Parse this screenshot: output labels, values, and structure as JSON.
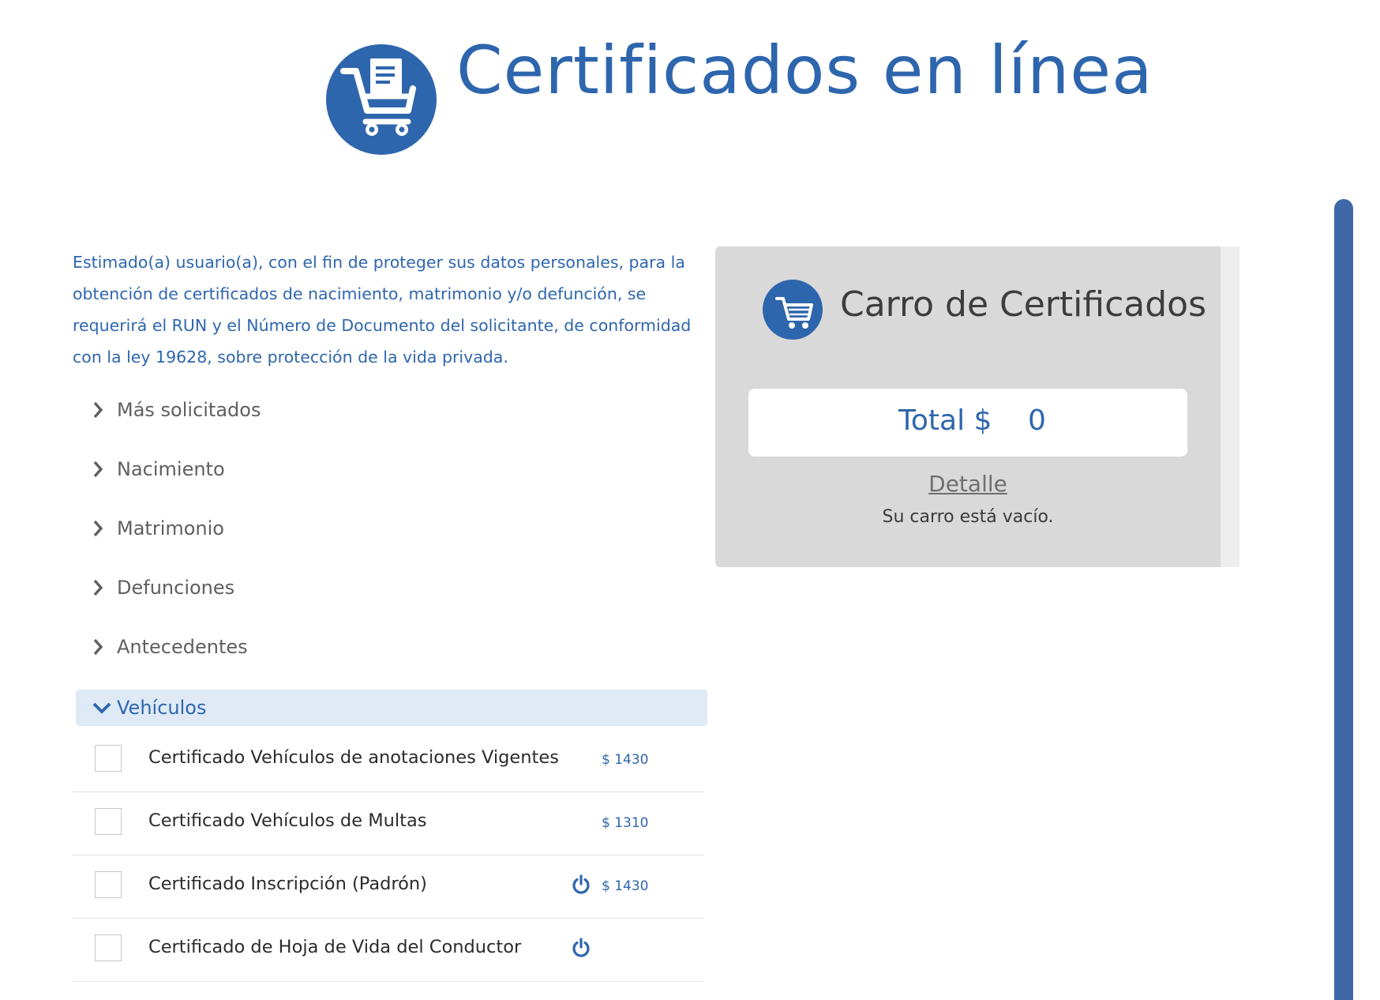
{
  "header": {
    "title": "Certificados en línea",
    "logo_icon": "cart-document-icon"
  },
  "notice": {
    "text": "Estimado(a) usuario(a), con el fin de proteger sus datos personales, para la obtención de certificados de nacimiento, matrimonio y/o defunción, se requerirá el RUN y el Número de Documento del solicitante, de conformidad con la ley 19628, sobre protección de la vida privada."
  },
  "categories": [
    {
      "label": "Más solicitados",
      "expanded": false
    },
    {
      "label": "Nacimiento",
      "expanded": false
    },
    {
      "label": "Matrimonio",
      "expanded": false
    },
    {
      "label": "Defunciones",
      "expanded": false
    },
    {
      "label": "Antecedentes",
      "expanded": false
    },
    {
      "label": "Vehículos",
      "expanded": true
    }
  ],
  "vehicle_certificates": [
    {
      "name": "Certificado Vehículos de anotaciones Vigentes",
      "price": "$ 1430",
      "online_icon": false,
      "checked": false
    },
    {
      "name": "Certificado Vehículos de Multas",
      "price": "$ 1310",
      "online_icon": false,
      "checked": false
    },
    {
      "name": "Certificado Inscripción (Padrón)",
      "price": "$ 1430",
      "online_icon": true,
      "checked": false
    },
    {
      "name": "Certificado de Hoja de Vida del Conductor",
      "price": "",
      "online_icon": true,
      "checked": false
    }
  ],
  "cart": {
    "title": "Carro de Certificados",
    "total_label": "Total $",
    "total_value": "0",
    "detail_label": "Detalle",
    "empty_message": "Su carro está vacío."
  },
  "colors": {
    "brand_blue": "#2e66ad",
    "accordion_open_bg": "#dfeaf6",
    "cart_panel_bg": "#d9d9d9",
    "scrollbar": "#3f68a8"
  }
}
